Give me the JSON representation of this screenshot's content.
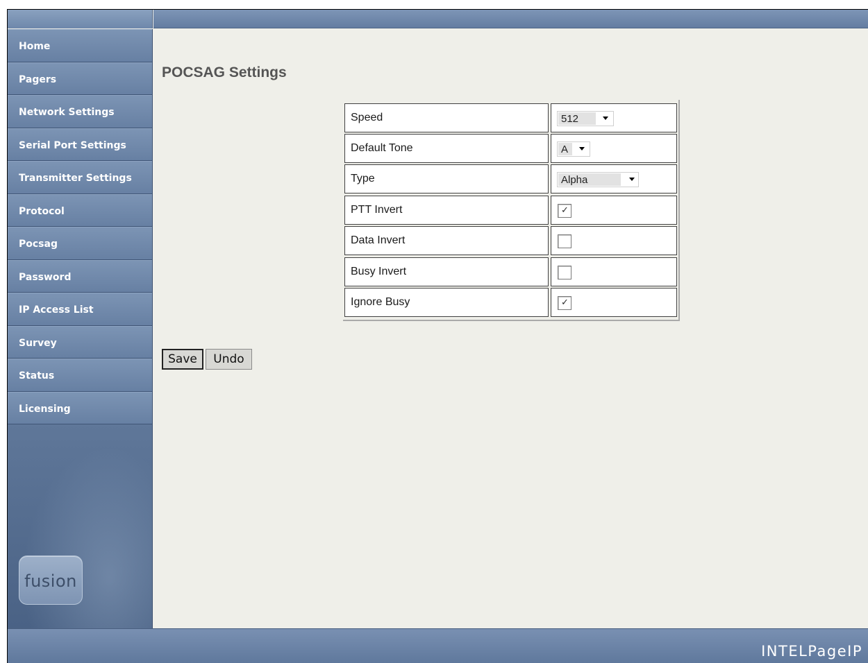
{
  "nav": {
    "items": [
      {
        "label": "Home"
      },
      {
        "label": "Pagers"
      },
      {
        "label": "Network Settings"
      },
      {
        "label": "Serial Port Settings"
      },
      {
        "label": "Transmitter Settings"
      },
      {
        "label": "Protocol"
      },
      {
        "label": "Pocsag"
      },
      {
        "label": "Password"
      },
      {
        "label": "IP Access List"
      },
      {
        "label": "Survey"
      },
      {
        "label": "Status"
      },
      {
        "label": "Licensing"
      }
    ]
  },
  "logo_text": "fusion",
  "page": {
    "title": "POCSAG Settings"
  },
  "settings": {
    "speed": {
      "label": "Speed",
      "value": "512"
    },
    "default_tone": {
      "label": "Default Tone",
      "value": "A"
    },
    "type": {
      "label": "Type",
      "value": "Alpha"
    },
    "ptt_invert": {
      "label": "PTT Invert",
      "checked": true
    },
    "data_invert": {
      "label": "Data Invert",
      "checked": false
    },
    "busy_invert": {
      "label": "Busy Invert",
      "checked": false
    },
    "ignore_busy": {
      "label": "Ignore Busy",
      "checked": true
    }
  },
  "buttons": {
    "save": "Save",
    "undo": "Undo"
  },
  "footer": {
    "brand": "INTELPageIP"
  },
  "icons": {
    "check": "✓"
  }
}
